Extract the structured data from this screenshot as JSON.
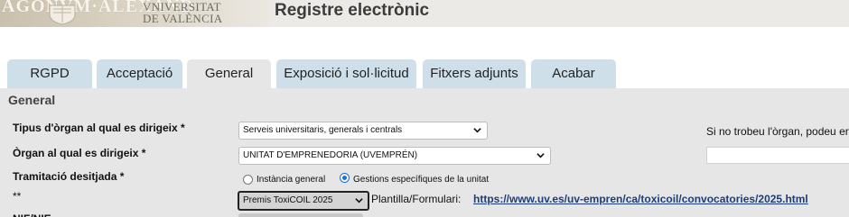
{
  "header": {
    "seal_text": "AGONVM·ALEXAND",
    "university_line1": "VNIVERSITAT",
    "university_line2": "DE VALÈNCIA",
    "title": "Registre electrònic"
  },
  "tabs": [
    {
      "label": "RGPD",
      "active": false
    },
    {
      "label": "Acceptació",
      "active": false
    },
    {
      "label": "General",
      "active": true
    },
    {
      "label": "Exposició i sol·licitud",
      "active": false
    },
    {
      "label": "Fitxers adjunts",
      "active": false
    },
    {
      "label": "Acabar",
      "active": false
    }
  ],
  "section": {
    "title": "General"
  },
  "form": {
    "organ_type_label": "Tipus d'òrgan al qual es dirigeix *",
    "organ_type_value": "Serveis universitaris, generals i centrals",
    "organ_label": "Òrgan al qual es dirigeix *",
    "organ_value": "UNITAT D'EMPRENEDORIA (UVEMPRÉN)",
    "not_found_text": "Si no trobeu l'òrgan, podeu er",
    "processing_label": "Tramitació desitjada *",
    "processing_options": [
      {
        "label": "Instància general",
        "selected": false
      },
      {
        "label": "Gestions específiques de la unitat",
        "selected": true
      }
    ],
    "required_marker": "**",
    "procedure_value": "Premis ToxiCOIL 2025",
    "template_label": "Plantilla/Formulari:",
    "template_link": "https://www.uv.es/uv-empren/ca/toxicoil/convocatories/2025.html",
    "next_label_partial": "NIF/NIE"
  },
  "colors": {
    "tab_inactive": "#cfdfe9",
    "tab_active": "#e6e6e6",
    "panel_bg": "#e6e6e6",
    "link": "#1d3c7a",
    "radio_selected": "#1a6fd8"
  }
}
